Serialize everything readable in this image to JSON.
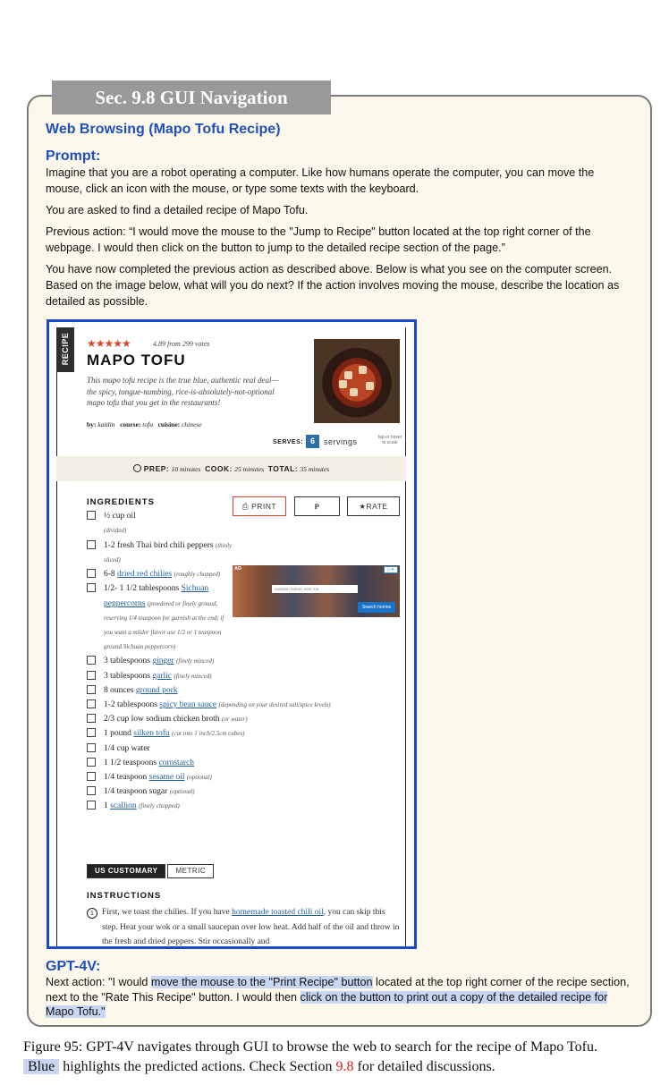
{
  "section_label": "Sec. 9.8 GUI Navigation",
  "box_title": "Web Browsing (Mapo Tofu Recipe)",
  "prompt": {
    "heading": "Prompt:",
    "p1": "Imagine that you are a robot operating a computer. Like how humans operate the computer, you can move the mouse, click an icon with the mouse, or type some texts with the keyboard.",
    "p2": "You are asked to find a detailed recipe of Mapo Tofu.",
    "p3": "Previous action: “I would move the mouse to the \"Jump to Recipe\" button located at the top right corner of the webpage. I would then click on the button to jump to the detailed recipe section of the page.”",
    "p4": "You have now completed the previous action as described above. Below is what you see on the computer screen. Based on the image below, what will you do next? If the action involves moving the mouse, describe the location as detailed as possible."
  },
  "recipe": {
    "side_tab": "RECIPE",
    "stars": "★★★★★",
    "votes": "4.89 from 299 votes",
    "title": "MAPO TOFU",
    "description": "This mapo tofu recipe is the true blue, authentic real deal—the spicy, tongue-numbing, rice-is-absolutely-not-optional mapo tofu that you get in the restaurants!",
    "meta": {
      "by_label": "by:",
      "by": "kaitlin",
      "course_label": "course:",
      "course": "tofu",
      "cuisine_label": "cuisine:",
      "cuisine": "chinese"
    },
    "serves_label": "SERVES:",
    "serves": "6",
    "servings_label": "servings",
    "scale_hint": "tap or hover to scale",
    "prep_label": "PREP:",
    "prep": "10 minutes",
    "cook_label": "COOK:",
    "cook": "25 minutes",
    "total_label": "TOTAL:",
    "total": "35 minutes",
    "ingredients_heading": "INGREDIENTS",
    "buttons": {
      "print": "PRINT",
      "pin": "P",
      "rate": "RATE"
    },
    "ingredients": [
      {
        "pre": "½ cup oil",
        "link": "",
        "post": "",
        "note": "",
        "sub": "(divided)"
      },
      {
        "pre": "1-2 fresh Thai bird chili peppers",
        "link": "",
        "post": "",
        "note": "(thinly sliced)",
        "sub": ""
      },
      {
        "pre": "6-8 ",
        "link": "dried red chilies",
        "post": "",
        "note": "(roughly chopped)",
        "sub": ""
      },
      {
        "pre": "1/2- 1 1/2 tablespoons ",
        "link": "Sichuan peppercorns",
        "post": "",
        "note": "(powdered or finely ground, reserving 1/4 teaspoon for garnish at the end; if you want a milder flavor use 1/2 or 1 teaspoon ground Sichuan peppercorn)",
        "sub": ""
      },
      {
        "pre": "3 tablespoons ",
        "link": "ginger",
        "post": "",
        "note": "(finely minced)",
        "sub": ""
      },
      {
        "pre": "3 tablespoons ",
        "link": "garlic",
        "post": "",
        "note": "(finely minced)",
        "sub": ""
      },
      {
        "pre": "8 ounces ",
        "link": "ground pork",
        "post": "",
        "note": "",
        "sub": ""
      },
      {
        "pre": "1-2 tablespoons ",
        "link": "spicy bean sauce",
        "post": "",
        "note": "(depending on your desired salt/spice levels)",
        "sub": ""
      },
      {
        "pre": "2/3 cup low sodium chicken broth",
        "link": "",
        "post": "",
        "note": "(or water)",
        "sub": ""
      },
      {
        "pre": "1 pound ",
        "link": "silken tofu",
        "post": "",
        "note": "(cut into 1 inch/2.5cm cubes)",
        "sub": ""
      },
      {
        "pre": "1/4 cup water",
        "link": "",
        "post": "",
        "note": "",
        "sub": ""
      },
      {
        "pre": "1 1/2 teaspoons ",
        "link": "cornstarch",
        "post": "",
        "note": "",
        "sub": ""
      },
      {
        "pre": "1/4 teaspoon ",
        "link": "sesame oil",
        "post": "",
        "note": "(optional)",
        "sub": ""
      },
      {
        "pre": "1/4 teaspoon sugar",
        "link": "",
        "post": "",
        "note": "(optional)",
        "sub": ""
      },
      {
        "pre": "1 ",
        "link": "scallion",
        "post": "",
        "note": "(finely chopped)",
        "sub": ""
      }
    ],
    "ad": {
      "tag": "AD",
      "close": "▷✕",
      "search_placeholder": "vacation homes near me",
      "button": "Search homes"
    },
    "units": {
      "on": "US CUSTOMARY",
      "off": "METRIC"
    },
    "instructions_heading": "INSTRUCTIONS",
    "step1": {
      "num": "1",
      "pre": "First, we toast the chilies. If you have ",
      "link": "homemade toasted chili oil",
      "post": ", you can skip this step. Heat your wok or a small saucepan over low heat. Add half of the oil and throw in the fresh and dried peppers. Stir occasionally and"
    }
  },
  "gpt": {
    "heading": "GPT-4V:",
    "t1": "Next action: \"I would ",
    "h1": "move the mouse to the \"Print Recipe\" button",
    "t2": " located at the top right corner of the recipe section, next to the \"Rate This Recipe\" button. I would then ",
    "h2": "click on the button to print out a copy of the detailed recipe for Mapo Tofu.\""
  },
  "caption": {
    "line1": "Figure 95: GPT-4V navigates through GUI to browse the web to search for the recipe of Mapo Tofu.",
    "blue": "Blue",
    "t2": " highlights the predicted actions. Check Section ",
    "ref": "9.8",
    "t3": " for detailed discussions."
  },
  "colors": {
    "accent_blue": "#1f4fbf",
    "highlight": "#c8d6f2",
    "panel_bg": "#fdf8ec",
    "screenshot_border": "#1948c8",
    "recipe_red": "#d9462b"
  }
}
